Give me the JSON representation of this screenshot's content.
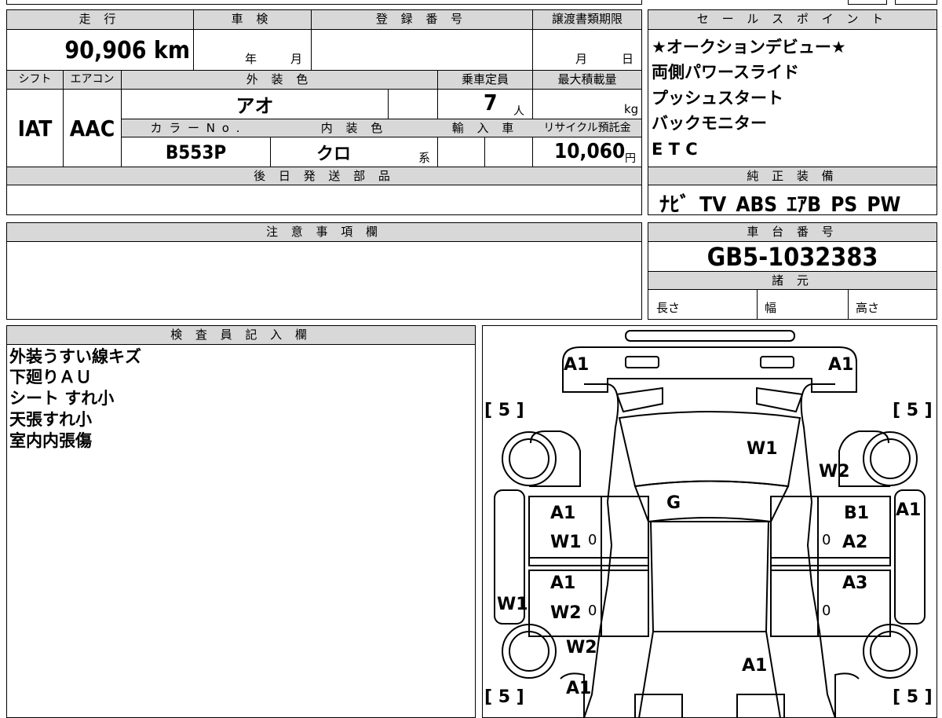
{
  "top_form": {
    "labels": {
      "mileage": "走 行",
      "inspection": "車 検",
      "registration": "登 録 番 号",
      "transfer_deadline": "譲渡書類期限",
      "shift": "シフト",
      "aircon": "エアコン",
      "exterior_color": "外 装 色",
      "capacity": "乗車定員",
      "max_load": "最大積載量",
      "color_no": "カ ラ ー N o .",
      "interior_color": "内 装 色",
      "import": "輸 入 車",
      "recycle": "リサイクル預託金",
      "later_parts": "後 日 発 送 部 品",
      "notes": "注 意 事 項 欄",
      "inspector": "検 査 員 記 入 欄"
    },
    "mileage_value": "90,906 km",
    "inspection_year_unit": "年",
    "inspection_month_unit": "月",
    "deadline_month_unit": "月",
    "deadline_day_unit": "日",
    "shift_value": "IAT",
    "aircon_value": "AAC",
    "exterior_color_value": "アオ",
    "capacity_value": "7",
    "capacity_unit": "人",
    "max_load_unit": "kg",
    "color_no_value": "B553P",
    "interior_color_value": "クロ",
    "interior_color_suffix": "系",
    "recycle_value": "10,060",
    "recycle_unit": "円"
  },
  "sales_points": {
    "header": "セ ー ル ス ポ イ ン ト",
    "items": [
      "★オークションデビュー★",
      "両側パワースライド",
      "プッシュスタート",
      "バックモニター",
      "E T C"
    ]
  },
  "equipment": {
    "header": "純 正 装 備",
    "value": "ﾅﾋﾞ TV ABS ｴｱB PS PW"
  },
  "chassis": {
    "header": "車 台 番 号",
    "value": "GB5-1032383"
  },
  "specs": {
    "header": "諸 元",
    "length": "長さ",
    "width": "幅",
    "height": "高さ"
  },
  "inspector_notes": [
    "外装うすい線キズ",
    "下廻りＡＵ",
    "シート すれ小",
    "天張すれ小",
    "室内内張傷"
  ],
  "diagram": {
    "marks": [
      {
        "id": "a1-front-left",
        "text": "A1"
      },
      {
        "id": "a1-front-right",
        "text": "A1"
      },
      {
        "id": "w1-windshield",
        "text": "W1"
      },
      {
        "id": "w2-right-glass",
        "text": "W2"
      },
      {
        "id": "g-hood",
        "text": "G"
      },
      {
        "id": "a1-left-front-door",
        "text": "A1"
      },
      {
        "id": "w1-left-front-door",
        "text": "W1"
      },
      {
        "id": "b1-right-front-door",
        "text": "B1"
      },
      {
        "id": "a2-right-front-door",
        "text": "A2"
      },
      {
        "id": "a1-right-fender",
        "text": "A1"
      },
      {
        "id": "a1-left-rear-door",
        "text": "A1"
      },
      {
        "id": "w2-left-rear-door",
        "text": "W2"
      },
      {
        "id": "a3-right-rear-door",
        "text": "A3"
      },
      {
        "id": "w1-left-side",
        "text": "W1"
      },
      {
        "id": "w2-left-rear-glass",
        "text": "W2"
      },
      {
        "id": "a1-roof-rear",
        "text": "A1"
      },
      {
        "id": "a1-rear-left",
        "text": "A1"
      }
    ],
    "tire_tl": "[ 5 ]",
    "tire_tr": "[ 5 ]",
    "tire_bl": "[ 5 ]",
    "tire_br": "[ 5 ]",
    "zero": "0"
  }
}
